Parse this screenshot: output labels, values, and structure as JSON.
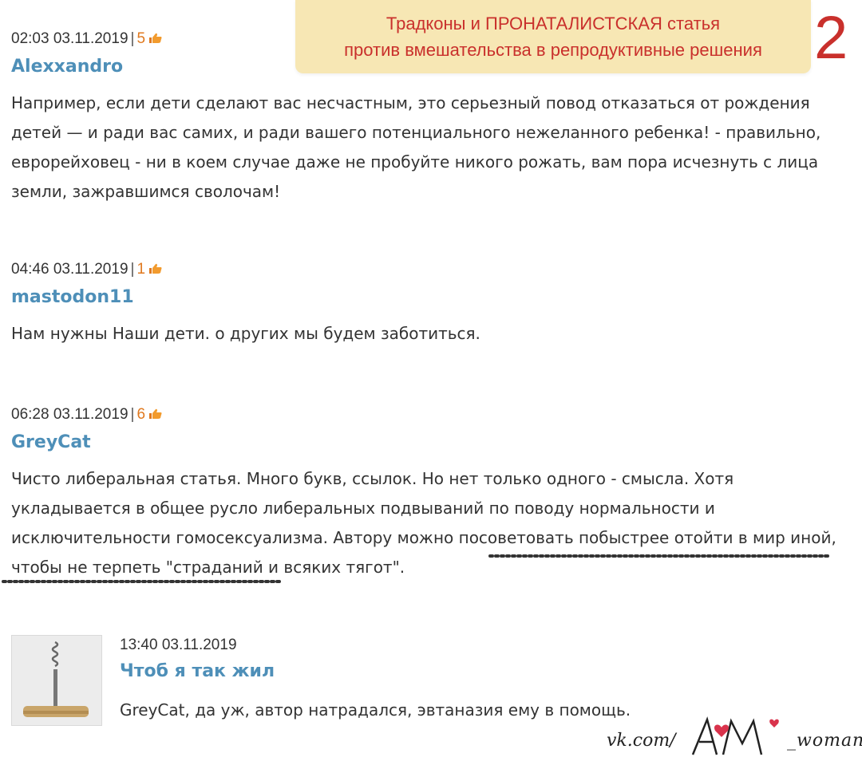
{
  "banner": {
    "line1": "Традконы и ПРОНАТАЛИСТСКАЯ статья",
    "line2": "против вмешательства в репродуктивные решения",
    "number": "2"
  },
  "comments": [
    {
      "time": "02:03 03.11.2019",
      "separator": "|",
      "rating": "5",
      "author": "Alexxandro",
      "text": "Например, если дети сделают вас несчастным, это серьезный повод отказаться от рождения детей — и ради вас самих, и ради вашего потенциального нежеланного ребенка! - правильно, еврорейховец - ни в коем случае даже не пробуйте никого рожать, вам пора исчезнуть с лица земли, зажравшимся сволочам!"
    },
    {
      "time": "04:46 03.11.2019",
      "separator": "|",
      "rating": "1",
      "author": "mastodon11",
      "text": "Нам нужны Наши дети. о других мы будем заботиться."
    },
    {
      "time": "06:28 03.11.2019",
      "separator": "|",
      "rating": "6",
      "author": "GreyCat",
      "text": "Чисто либеральная статья. Много букв, ссылок. Но нет только одного - смысла. Хотя укладывается в общее русло либеральных подвываний по поводу нормальности и исключительности гомосексуализма. Автору можно посоветовать побыстрее отойти в мир иной, чтобы не терпеть \"страданий и всяких тягот\"."
    }
  ],
  "reply": {
    "time": "13:40 03.11.2019",
    "author": "Чтоб я так жил",
    "text": "GreyCat, да уж, автор натрадался, эвтаназия ему в помощь."
  },
  "watermark": {
    "prefix": "vk.com/",
    "logo_letters": "AM",
    "suffix": "_woman"
  },
  "icons": {
    "rating": "thumbs-up-icon",
    "avatar": "corkscrew-avatar"
  },
  "colors": {
    "author_link": "#4e8fb8",
    "rating": "#e0791f",
    "banner_text": "#c9302c",
    "banner_bg": "#f7e7b4"
  }
}
